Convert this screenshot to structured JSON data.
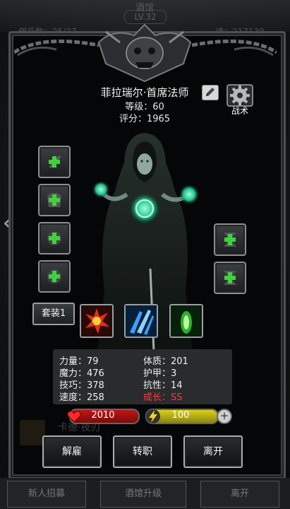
{
  "background": {
    "title": "酒馆",
    "level_badge": "LV.32",
    "left_info": "佣兵数：25/27",
    "right_info": "魂：217130"
  },
  "character": {
    "name": "菲拉瑞尔·首席法师",
    "level": "等级：60",
    "score": "评分：1965"
  },
  "tactics": {
    "label": "战术",
    "icon": "gear-icon"
  },
  "equipment_slots": [
    {
      "icon": "staff-plus-icon"
    },
    {
      "icon": "armor-plus-icon"
    },
    {
      "icon": "plus-icon"
    },
    {
      "icon": "plus-icon"
    },
    {
      "icon": "hourglass-plus-icon"
    },
    {
      "icon": "hourglass-plus-icon"
    }
  ],
  "set_button": "套装1",
  "skills": [
    {
      "icon": "fire-burst-icon",
      "color": "#e0301a"
    },
    {
      "icon": "ice-shards-icon",
      "color": "#3aa0ff"
    },
    {
      "icon": "green-flame-icon",
      "color": "#5ae05a"
    }
  ],
  "stats": {
    "strength": "力量：79",
    "constitution": "体质：201",
    "magic": "魔力：476",
    "armor": "护甲：3",
    "skill": "技巧：378",
    "resistance": "抗性：14",
    "speed": "速度：258",
    "growth": "成长：SS"
  },
  "bars": {
    "hp": "2010",
    "energy": "100"
  },
  "ghost": {
    "name": "卡德·夜刃"
  },
  "actions": {
    "dismiss": "解雇",
    "change_class": "转职",
    "leave": "离开"
  },
  "bottom_tabs": {
    "recruit": "新人招募",
    "upgrade": "酒馆升级",
    "leave": "离开"
  },
  "colors": {
    "accent_red": "#ff3b3b",
    "hp": "#c01616",
    "energy": "#d9d11a",
    "plus_green": "#3fd23f"
  }
}
